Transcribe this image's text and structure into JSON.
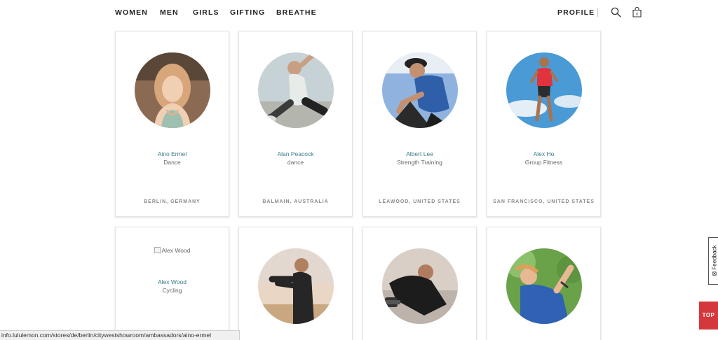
{
  "nav": {
    "items": [
      "WOMEN",
      "MEN",
      "GIRLS",
      "GIFTING",
      "BREATHE"
    ],
    "profile": "PROFILE",
    "bag_count": "0"
  },
  "ambassadors": [
    {
      "name": "Aino Ermel",
      "discipline": "Dance",
      "location": "BERLIN, GERMANY"
    },
    {
      "name": "Alan Peacock",
      "discipline": "dance",
      "location": "BALMAIN, AUSTRALIA"
    },
    {
      "name": "Albert Lee",
      "discipline": "Strength Training",
      "location": "LEAWOOD, UNITED STATES"
    },
    {
      "name": "Alex Ho",
      "discipline": "Group Fitness",
      "location": "SAN FRANCISCO, UNITED STATES"
    },
    {
      "name": "Alex Wood",
      "discipline": "Cycling",
      "image_alt": "Alex  Wood"
    }
  ],
  "feedback": {
    "label": "Feedback"
  },
  "top_button": {
    "label": "TOP"
  },
  "status_bar": {
    "url": "info.lululemon.com/stores/de/berlin/citywestshowroom/ambassadors/aino-ermel"
  },
  "colors": {
    "name_link": "#3d7a8a",
    "top_button": "#d5383c"
  }
}
